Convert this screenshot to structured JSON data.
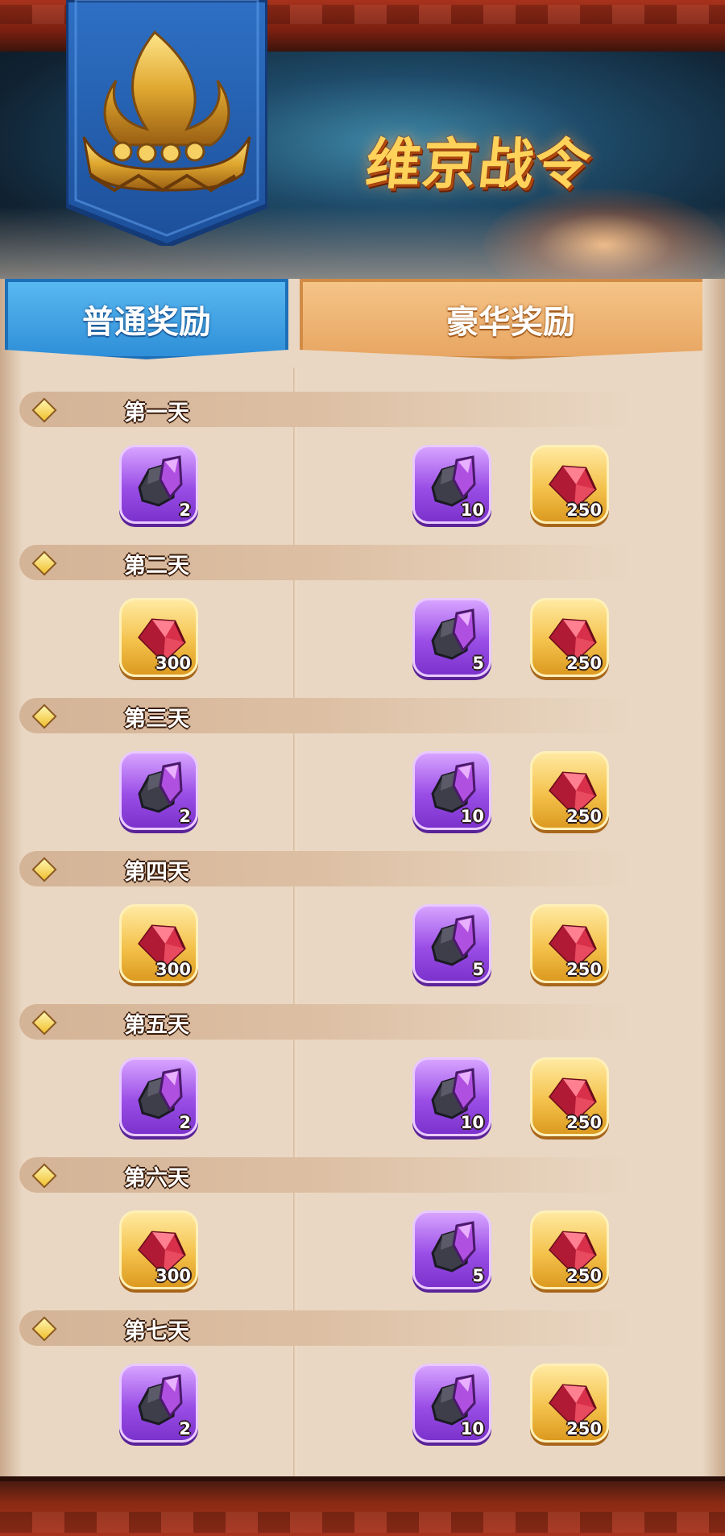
{
  "banner": {
    "title": "维京战令"
  },
  "tabs": {
    "normal": "普通奖励",
    "deluxe": "豪华奖励"
  },
  "colors": {
    "normal_tab": "#3a9ae0",
    "deluxe_tab": "#eeb272",
    "panel": "#e9d7c3",
    "frame": "#a8321c"
  },
  "days": [
    {
      "label": "第一天",
      "normal": {
        "type": "ore",
        "qty": "2"
      },
      "deluxe": [
        {
          "type": "ore",
          "qty": "10"
        },
        {
          "type": "ruby",
          "qty": "250"
        }
      ]
    },
    {
      "label": "第二天",
      "normal": {
        "type": "ruby",
        "qty": "300"
      },
      "deluxe": [
        {
          "type": "ore",
          "qty": "5"
        },
        {
          "type": "ruby",
          "qty": "250"
        }
      ]
    },
    {
      "label": "第三天",
      "normal": {
        "type": "ore",
        "qty": "2"
      },
      "deluxe": [
        {
          "type": "ore",
          "qty": "10"
        },
        {
          "type": "ruby",
          "qty": "250"
        }
      ]
    },
    {
      "label": "第四天",
      "normal": {
        "type": "ruby",
        "qty": "300"
      },
      "deluxe": [
        {
          "type": "ore",
          "qty": "5"
        },
        {
          "type": "ruby",
          "qty": "250"
        }
      ]
    },
    {
      "label": "第五天",
      "normal": {
        "type": "ore",
        "qty": "2"
      },
      "deluxe": [
        {
          "type": "ore",
          "qty": "10"
        },
        {
          "type": "ruby",
          "qty": "250"
        }
      ]
    },
    {
      "label": "第六天",
      "normal": {
        "type": "ruby",
        "qty": "300"
      },
      "deluxe": [
        {
          "type": "ore",
          "qty": "5"
        },
        {
          "type": "ruby",
          "qty": "250"
        }
      ]
    },
    {
      "label": "第七天",
      "normal": {
        "type": "ore",
        "qty": "2"
      },
      "deluxe": [
        {
          "type": "ore",
          "qty": "10"
        },
        {
          "type": "ruby",
          "qty": "250"
        }
      ]
    }
  ]
}
